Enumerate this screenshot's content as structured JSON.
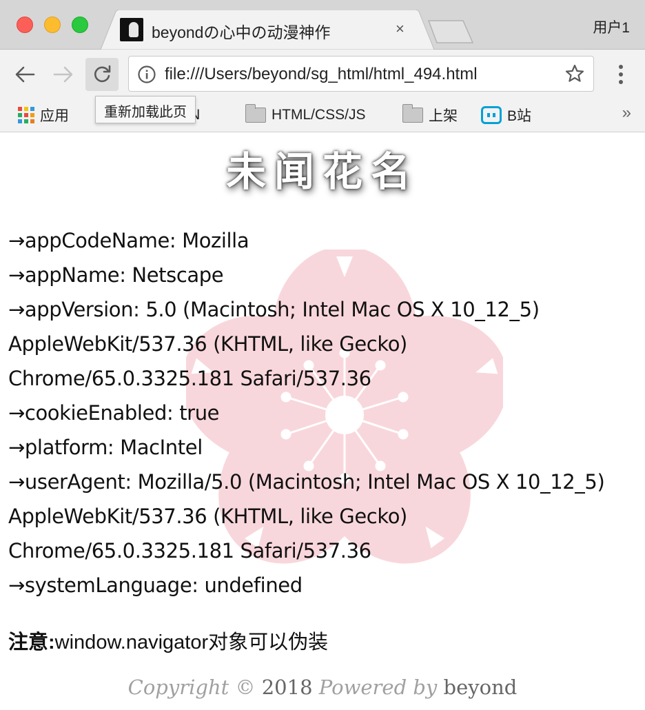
{
  "window": {
    "tab_title": "beyondの心中の动漫神作",
    "tab_close": "×",
    "profile": "用户1"
  },
  "toolbar": {
    "url": "file:///Users/beyond/sg_html/html_494.html",
    "reload_tooltip": "重新加载此页"
  },
  "bookmarks": {
    "apps": "应用",
    "csdn_partial": "DN",
    "folder1": "HTML/CSS/JS",
    "folder2": "上架",
    "bilibili": "B站",
    "more": "»"
  },
  "page": {
    "heading": "未闻花名",
    "lines": [
      "→appCodeName: Mozilla",
      "→appName: Netscape",
      "→appVersion: 5.0 (Macintosh; Intel Mac OS X 10_12_5)",
      "AppleWebKit/537.36 (KHTML, like Gecko)",
      "Chrome/65.0.3325.181 Safari/537.36",
      "→cookieEnabled: true",
      "→platform: MacIntel",
      "→userAgent: Mozilla/5.0 (Macintosh; Intel Mac OS X 10_12_5)",
      "AppleWebKit/537.36 (KHTML, like Gecko)",
      "Chrome/65.0.3325.181 Safari/537.36",
      "→systemLanguage: undefined"
    ],
    "note_label": "注意:",
    "note_text": "window.navigator对象可以伪装",
    "copyright": {
      "prefix": "Copyright ©",
      "year": "2018",
      "powered": "Powered by",
      "author": "beyond"
    }
  },
  "colors": {
    "blossom": "#f8d7dc",
    "accent_blue": "#00a1d6"
  }
}
